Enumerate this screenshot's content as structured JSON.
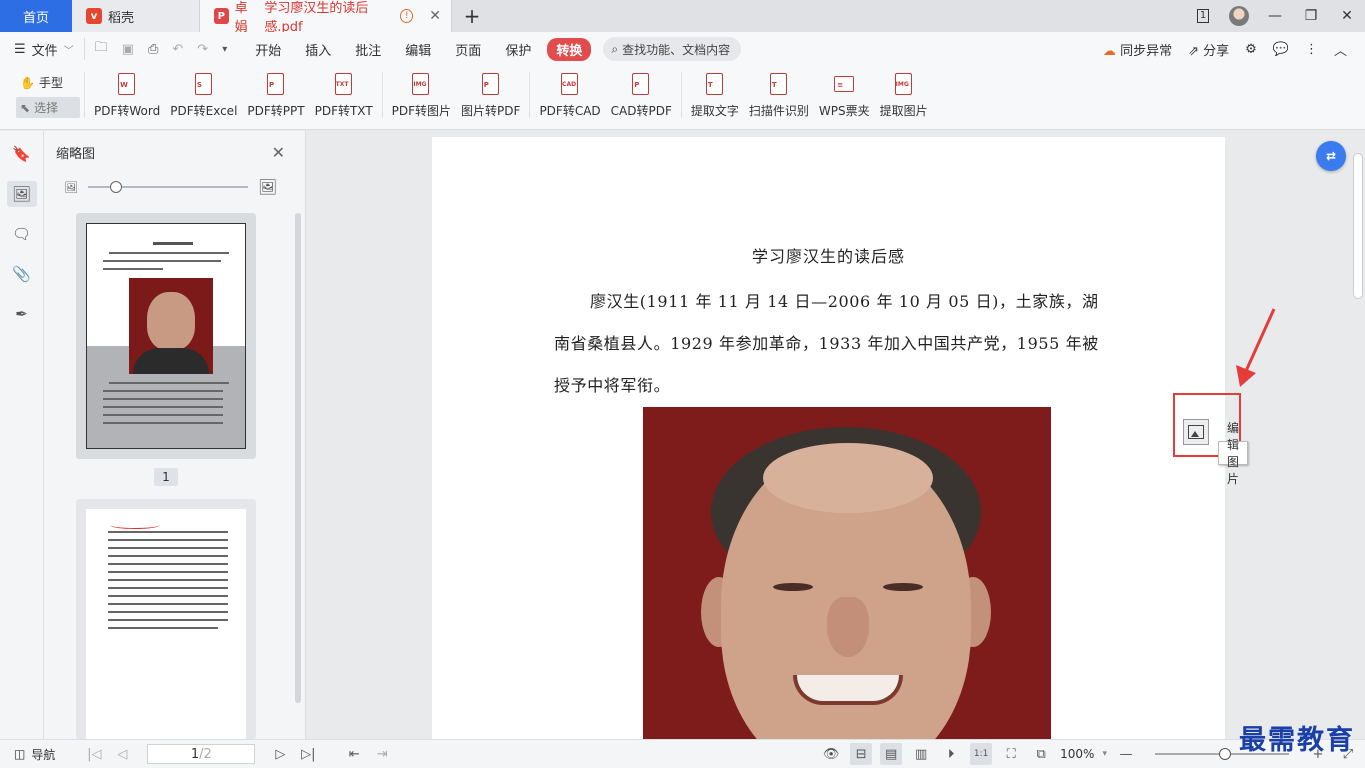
{
  "tabs": {
    "home": "首页",
    "daoke": "稻壳",
    "doc_owner": "卓娟",
    "doc_title": "学习廖汉生的读后感.pdf",
    "win_badge": "1"
  },
  "menu": {
    "file": "文件",
    "items": [
      "开始",
      "插入",
      "批注",
      "编辑",
      "页面",
      "保护",
      "转换"
    ],
    "active": "转换",
    "search_placeholder": "查找功能、文档内容",
    "sync": "同步异常",
    "share": "分享"
  },
  "ribbon": {
    "hand": "手型",
    "select": "选择",
    "buttons": [
      {
        "label": "PDF转Word",
        "tag": "W"
      },
      {
        "label": "PDF转Excel",
        "tag": "S"
      },
      {
        "label": "PDF转PPT",
        "tag": "P"
      },
      {
        "label": "PDF转TXT",
        "tag": "TXT"
      },
      {
        "label": "PDF转图片",
        "tag": "IMG"
      },
      {
        "label": "图片转PDF",
        "tag": "P"
      },
      {
        "label": "PDF转CAD",
        "tag": "CAD"
      },
      {
        "label": "CAD转PDF",
        "tag": "P"
      },
      {
        "label": "提取文字",
        "tag": "T"
      },
      {
        "label": "扫描件识别",
        "tag": "T"
      },
      {
        "label": "WPS票夹",
        "tag": "≡"
      },
      {
        "label": "提取图片",
        "tag": "IMG"
      }
    ]
  },
  "thumbnails": {
    "title": "缩略图",
    "page_label": "1"
  },
  "document": {
    "title": "学习廖汉生的读后感",
    "paragraph": "廖汉生(1911 年 11 月 14 日—2006 年 10 月 05 日)，土家族，湖南省桑植县人。1929 年参加革命，1933 年加入中国共产党，1955 年被授予中将军衔。",
    "tooltip": "编辑图片"
  },
  "statusbar": {
    "nav": "导航",
    "current_page": "1",
    "total_pages": "/2",
    "zoom": "100%"
  },
  "watermark": "最需教育",
  "colors": {
    "accent": "#2d6ee4",
    "active_tab_red": "#e34c4c",
    "annotation_red": "#e63b3b"
  }
}
